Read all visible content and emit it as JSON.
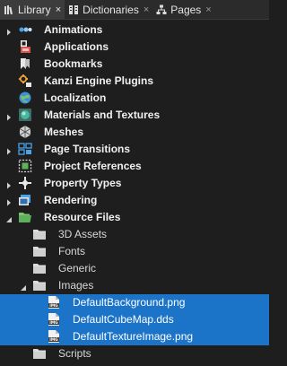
{
  "tabs": [
    {
      "label": "Library",
      "icon": "library-icon",
      "active": true
    },
    {
      "label": "Dictionaries",
      "icon": "dictionaries-icon",
      "active": false
    },
    {
      "label": "Pages",
      "icon": "pages-icon",
      "active": false
    }
  ],
  "close_glyph": "×",
  "tree": [
    {
      "label": "Animations",
      "icon": "animations-icon",
      "level": 0,
      "expander": "collapsed"
    },
    {
      "label": "Applications",
      "icon": "applications-icon",
      "level": 0,
      "expander": "none"
    },
    {
      "label": "Bookmarks",
      "icon": "bookmarks-icon",
      "level": 0,
      "expander": "none"
    },
    {
      "label": "Kanzi Engine Plugins",
      "icon": "plugins-icon",
      "level": 0,
      "expander": "none"
    },
    {
      "label": "Localization",
      "icon": "localization-icon",
      "level": 0,
      "expander": "none"
    },
    {
      "label": "Materials and Textures",
      "icon": "materials-icon",
      "level": 0,
      "expander": "collapsed"
    },
    {
      "label": "Meshes",
      "icon": "meshes-icon",
      "level": 0,
      "expander": "none"
    },
    {
      "label": "Page Transitions",
      "icon": "page-transitions-icon",
      "level": 0,
      "expander": "collapsed"
    },
    {
      "label": "Project References",
      "icon": "project-references-icon",
      "level": 0,
      "expander": "none"
    },
    {
      "label": "Property Types",
      "icon": "property-types-icon",
      "level": 0,
      "expander": "collapsed"
    },
    {
      "label": "Rendering",
      "icon": "rendering-icon",
      "level": 0,
      "expander": "collapsed"
    },
    {
      "label": "Resource Files",
      "icon": "folder-open-icon",
      "level": 0,
      "expander": "expanded"
    },
    {
      "label": "3D Assets",
      "icon": "folder-icon",
      "level": 1,
      "expander": "none"
    },
    {
      "label": "Fonts",
      "icon": "folder-icon",
      "level": 1,
      "expander": "none"
    },
    {
      "label": "Generic",
      "icon": "folder-icon",
      "level": 1,
      "expander": "none"
    },
    {
      "label": "Images",
      "icon": "folder-icon",
      "level": 1,
      "expander": "expanded"
    },
    {
      "label": "DefaultBackground.png",
      "icon": "image-file-icon",
      "level": 2,
      "expander": "none",
      "selected": true
    },
    {
      "label": "DefaultCubeMap.dds",
      "icon": "image-file-icon",
      "level": 2,
      "expander": "none",
      "selected": true
    },
    {
      "label": "DefaultTextureImage.png",
      "icon": "image-file-icon",
      "level": 2,
      "expander": "none",
      "selected": true
    },
    {
      "label": "Scripts",
      "icon": "folder-icon",
      "level": 1,
      "expander": "none"
    }
  ],
  "colors": {
    "background": "#1e1e1e",
    "selection": "#1c74c8",
    "tab_active": "#3c3c3c",
    "folder": "#d9d9d9"
  }
}
